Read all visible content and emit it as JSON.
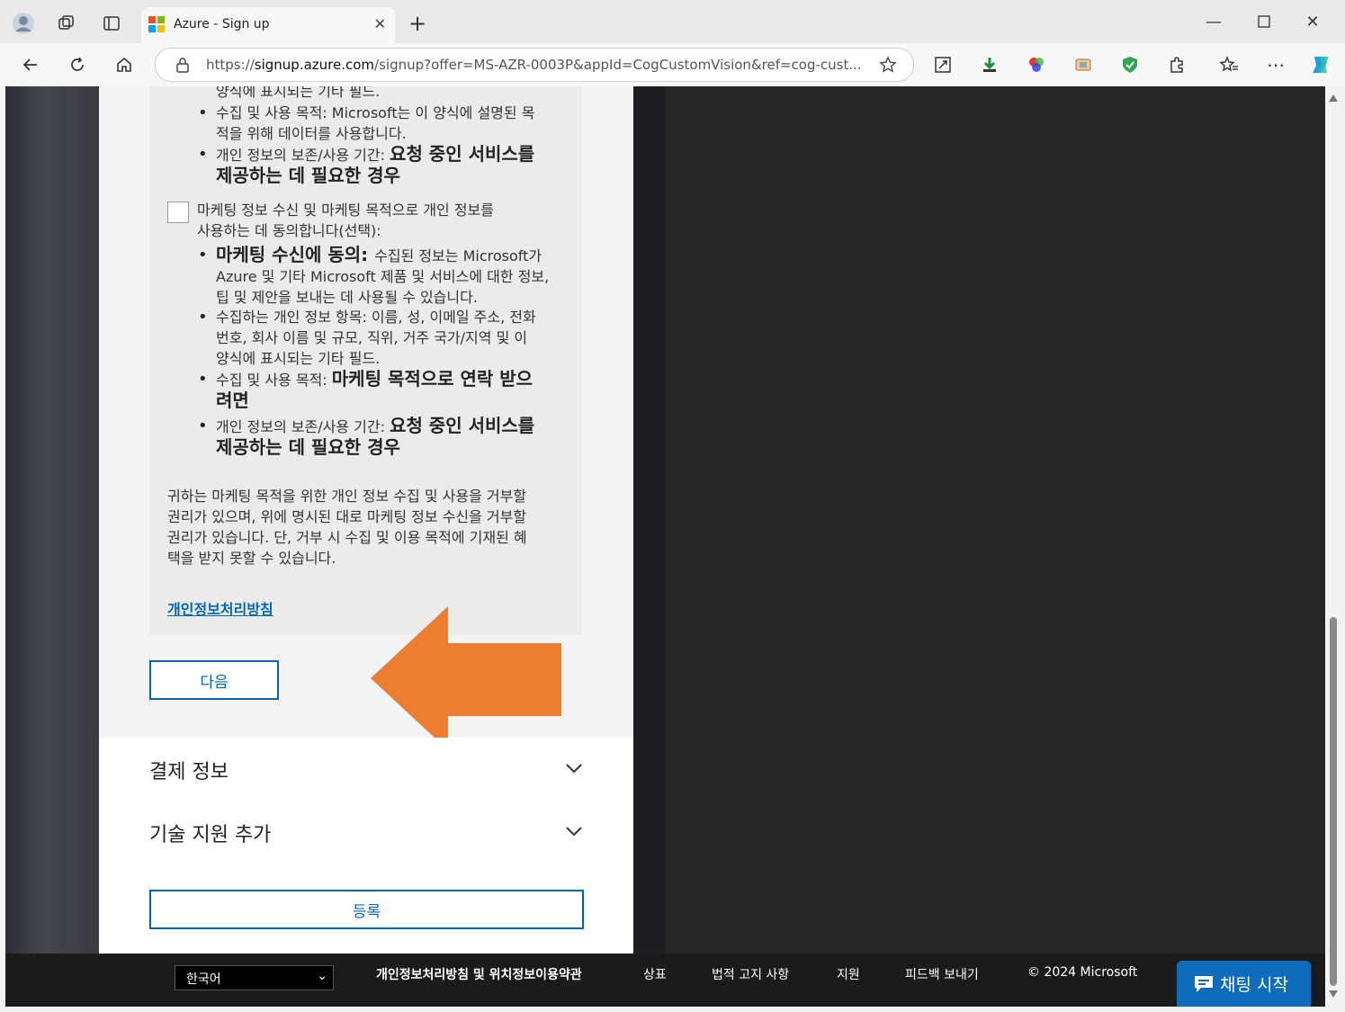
{
  "browser": {
    "tab_title": "Azure - Sign up",
    "url_prefix": "https://",
    "url_domain": "signup.azure.com",
    "url_rest": "/signup?offer=MS-AZR-0003P&appId=CogCustomVision&ref=cog-cust..."
  },
  "consent": {
    "line_top": "양식에 표시되는 기타 필드.",
    "b1_a": "수집 및 사용 목적: Microsoft는 이 양식에 설명된 목",
    "b1_b": "적을 위해 데이터를 사용합니다.",
    "b2_label": "개인 정보의 보존/사용 기간: ",
    "b2_bold_a": "요청 중인 서비스를",
    "b2_bold_b": "제공하는 데 필요한 경우",
    "checkbox_a": "마케팅 정보 수신 및 마케팅 목적으로 개인 정보를",
    "checkbox_b": "사용하는 데 동의합니다(선택):",
    "m1_bold": "마케팅 수신에 동의: ",
    "m1_a": "수집된 정보는 Microsoft가",
    "m1_b": "Azure 및 기타 Microsoft 제품 및 서비스에 대한 정보,",
    "m1_c": "팁 및 제안을 보내는 데 사용될 수 있습니다.",
    "m2_a": "수집하는 개인 정보 항목: 이름, 성, 이메일 주소, 전화",
    "m2_b": "번호, 회사 이름 및 규모, 직위, 거주 국가/지역 및 이",
    "m2_c": "양식에 표시되는 기타 필드.",
    "m3_label": "수집 및 사용 목적: ",
    "m3_bold_a": "마케팅 목적으로 연락 받으",
    "m3_bold_b": "려면",
    "m4_label": "개인 정보의 보존/사용 기간: ",
    "m4_bold_a": "요청 중인 서비스를",
    "m4_bold_b": "제공하는 데 필요한 경우",
    "refuse_a": "귀하는 마케팅 목적을 위한 개인 정보 수집 및 사용을 거부할",
    "refuse_b": "권리가 있으며, 위에 명시된 대로 마케팅 정보 수신을 거부할",
    "refuse_c": "권리가 있습니다. 단, 거부 시 수집 및 이용 목적에 기재된 혜",
    "refuse_d": "택을 받지 못할 수 있습니다.",
    "privacy_link": "개인정보처리방침"
  },
  "buttons": {
    "next": "다음",
    "register": "등록"
  },
  "sections": {
    "payment": "결제 정보",
    "support": "기술 지원 추가"
  },
  "footer": {
    "language": "한국어",
    "links": [
      "개인정보처리방침 및 위치정보이용약관",
      "상표",
      "법적 고지 사항",
      "지원",
      "피드백 보내기"
    ],
    "copyright": "© 2024 Microsoft",
    "chat": "채팅 시작"
  },
  "colors": {
    "accent": "#0067b8",
    "arrow": "#ed7d31"
  }
}
